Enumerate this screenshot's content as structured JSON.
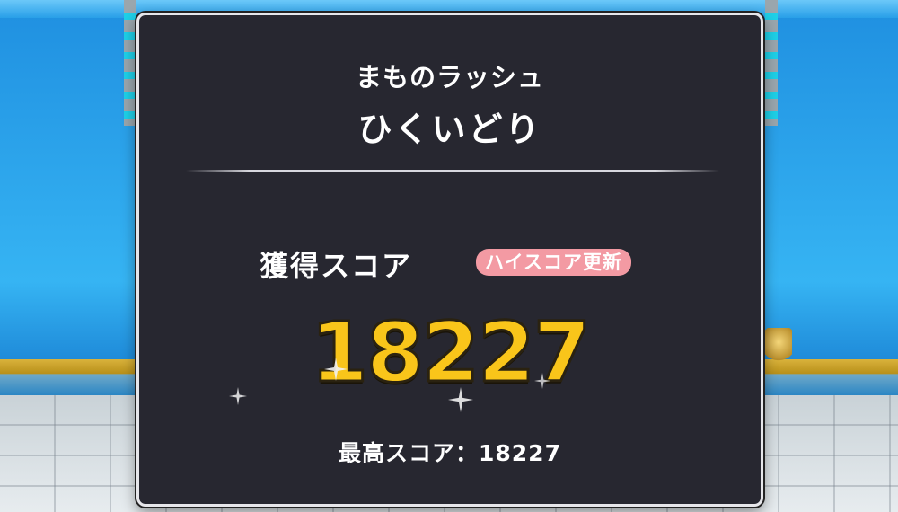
{
  "result": {
    "subtitle": "まものラッシュ",
    "title": "ひくいどり",
    "score_label": "獲得スコア",
    "highscore_badge": "ハイスコア更新",
    "score_value": "18227",
    "best_score": "最高スコア：18227"
  },
  "colors": {
    "panel_bg": "#272730",
    "score_gold": "#f9c51a",
    "badge_pink": "#f39aa3"
  },
  "icons": [
    "sparkle-icon"
  ]
}
